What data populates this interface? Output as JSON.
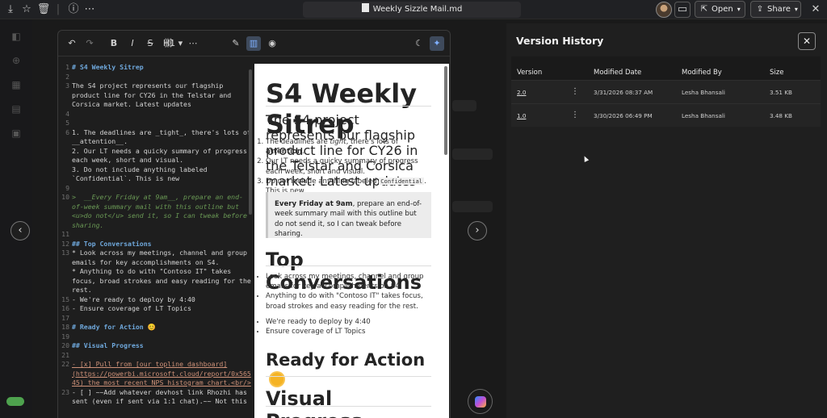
{
  "file": {
    "title": "Weekly Sizzle Mail.md"
  },
  "header": {
    "open_label": "Open",
    "share_label": "Share"
  },
  "toolbar": {
    "heading_label": "H1"
  },
  "editor": {
    "lines": [
      {
        "n": "1",
        "text": "# S4 Weekly Sitrep",
        "style": "hd"
      },
      {
        "n": "2",
        "text": "",
        "style": ""
      },
      {
        "n": "3",
        "text": "The S4 project represents our flagship product line for CY26 in the Telstar and Corsica market. Latest updates",
        "style": ""
      },
      {
        "n": "4",
        "text": "",
        "style": ""
      },
      {
        "n": "5",
        "text": "",
        "style": ""
      },
      {
        "n": "6",
        "text": "1. The deadlines are _tight_, there's lots of __attention__.",
        "style": ""
      },
      {
        "n": "",
        "text": "2. Our LT needs a quicky summary of progress each week, short and visual.",
        "style": ""
      },
      {
        "n": "",
        "text": "3. Do not include anything labeled `Confidential`. This is new",
        "style": ""
      },
      {
        "n": "9",
        "text": "",
        "style": ""
      },
      {
        "n": "10",
        "text": ">  __Every Friday at 9am__, prepare an end-of-week summary mail with this outline but <u>do not</u> send it, so I can tweak before sharing.",
        "style": "it"
      },
      {
        "n": "11",
        "text": "",
        "style": ""
      },
      {
        "n": "12",
        "text": "## Top Conversations",
        "style": "hd"
      },
      {
        "n": "13",
        "text": "* Look across my meetings, channel and group emails for key accomplishments on S4.",
        "style": ""
      },
      {
        "n": "",
        "text": "* Anything to do with \"Contoso IT\" takes focus, broad strokes and easy reading for the rest.",
        "style": ""
      },
      {
        "n": "15",
        "text": "- We're ready to deploy by 4:40",
        "style": ""
      },
      {
        "n": "16",
        "text": "- Ensure coverage of LT Topics",
        "style": ""
      },
      {
        "n": "17",
        "text": "",
        "style": ""
      },
      {
        "n": "18",
        "text": "# Ready for Action 😊",
        "style": "hd"
      },
      {
        "n": "19",
        "text": "",
        "style": ""
      },
      {
        "n": "20",
        "text": "## Visual Progress",
        "style": "hd"
      },
      {
        "n": "21",
        "text": "",
        "style": ""
      },
      {
        "n": "22",
        "text": "- [x] Pull from [our topline dashboard](https://powerbi.microsoft.cloud/report/0x56545) the most recent NPS histogram chart.<br/>",
        "style": "lnkline"
      },
      {
        "n": "23",
        "text": "- [ ] ~~Add whatever devhost link Rhozhi has sent (even if sent via 1:1 chat).~~ Not this",
        "style": ""
      }
    ]
  },
  "preview": {
    "h1": "S4 Weekly Sitrep",
    "intro": "The S4 project represents our flagship product line for CY26 in the Telstar and Corsica market. Latest updates",
    "li1_a": "The deadlines are ",
    "li1_b": "tight",
    "li1_c": ", there's lots of ",
    "li1_d": "attention",
    "li1_e": ".",
    "li2": "Our LT needs a quicky summary of progress each week, short and visual.",
    "li3_a": "Do not include anything labeled ",
    "li3_code": "Confidential",
    "li3_b": ". This is new",
    "quote_bold": "Every Friday at 9am",
    "quote_rest": ", prepare an end-of-week summary mail with this outline but do not send it, so I can tweak before sharing.",
    "h2_top": "Top Conversations",
    "b1": "Look across my meetings, channel and group emails for key accomplishments on S4.",
    "b2": "Anything to do with \"Contoso IT\" takes focus, broad strokes and easy reading for the rest.",
    "b3": "We're ready to deploy by 4:40",
    "b4": "Ensure coverage of LT Topics",
    "h1_ready": "Ready for Action",
    "h2_visual": "Visual Progress"
  },
  "version_history": {
    "title": "Version History",
    "columns": [
      "Version",
      "Modified Date",
      "Modified By",
      "Size"
    ],
    "rows": [
      {
        "version": "2.0",
        "date": "3/31/2026 08:37 AM",
        "by": "Lesha Bhansali",
        "size": "3.51 KB"
      },
      {
        "version": "1.0",
        "date": "3/30/2026 06:49 PM",
        "by": "Lesha Bhansali",
        "size": "3.48 KB"
      }
    ]
  }
}
